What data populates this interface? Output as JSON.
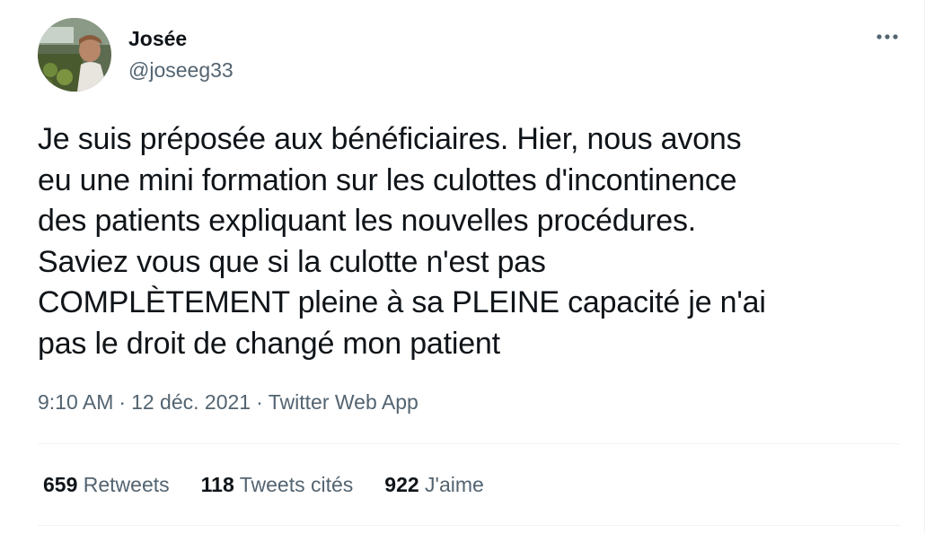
{
  "author": {
    "display_name": "Josée",
    "handle": "@joseeg33"
  },
  "icons": {
    "more": "more-horizontal-icon",
    "avatar": "profile-photo"
  },
  "tweet": {
    "text": "Je suis préposée aux bénéficiaires. Hier, nous avons\neu une mini formation sur les culottes d'incontinence\ndes patients expliquant les nouvelles procédures.\nSaviez vous que si la culotte n'est pas\nCOMPLÈTEMENT pleine à sa PLEINE capacité je n'ai\npas le droit de changé mon patient"
  },
  "meta": {
    "time": "9:10 AM",
    "separator": "·",
    "date": "12 déc. 2021",
    "source": "Twitter Web App"
  },
  "stats": [
    {
      "count": "659",
      "label": "Retweets"
    },
    {
      "count": "118",
      "label": "Tweets cités"
    },
    {
      "count": "922",
      "label": "J'aime"
    }
  ],
  "colors": {
    "text_primary": "#0f1419",
    "text_secondary": "#536471",
    "divider": "#eff3f4"
  }
}
